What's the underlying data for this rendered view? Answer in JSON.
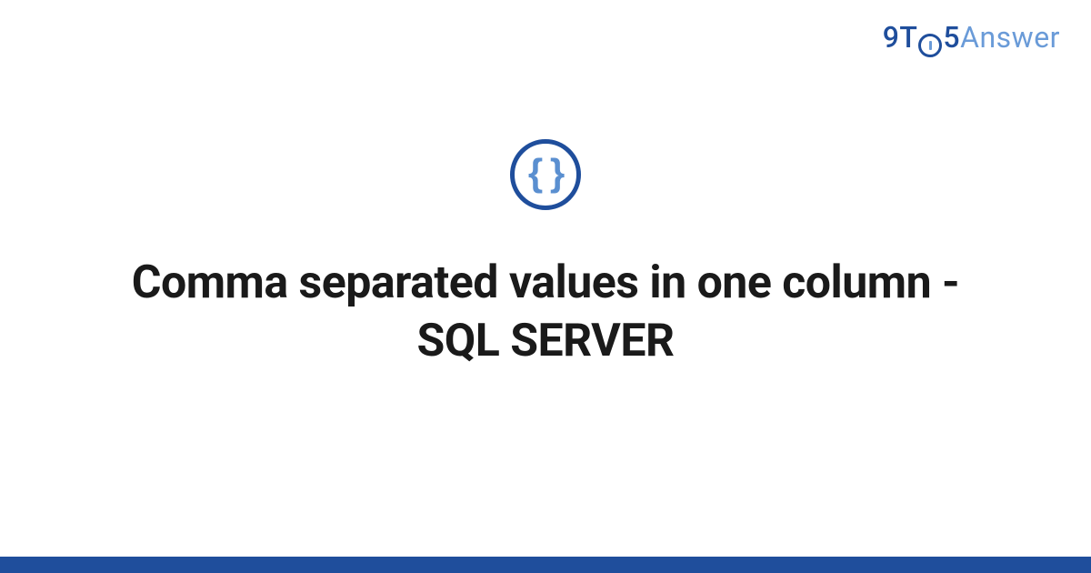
{
  "logo": {
    "part1": "9T",
    "part2": "5",
    "part3": "Answer"
  },
  "icon": {
    "braces": "{ }"
  },
  "title": "Comma separated values in one column - SQL SERVER"
}
